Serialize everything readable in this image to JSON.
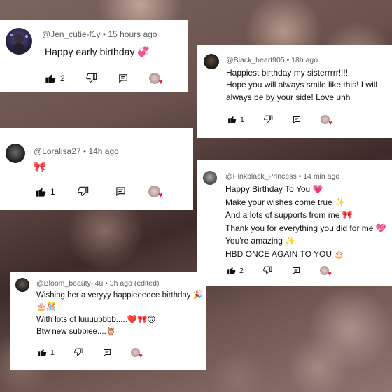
{
  "comments": [
    {
      "handle": "@Jen_cutie-f1y",
      "time": "15 hours ago",
      "lines": [
        "Happy early birthday 💞"
      ],
      "likes": "2"
    },
    {
      "handle": "@Black_heart905",
      "time": "18h ago",
      "lines": [
        "Happiest birthday my sisterrrrr!!!!",
        "Hope you will always smile like this! I will",
        "always be by your side! Love uhh"
      ],
      "likes": "1"
    },
    {
      "handle": "@Loralisa27",
      "time": "14h ago",
      "lines": [
        "🎀"
      ],
      "likes": "1"
    },
    {
      "handle": "@Pinkblack_Princess",
      "time": "14 min ago",
      "lines": [
        "Happy Birthday To You 💗",
        "Make your wishes come true ✨",
        "And a lots of supports from me 🎀",
        "Thank you for everything you did for me 💖",
        "You're amazing ✨",
        "HBD ONCE AGAIN TO YOU 🎂"
      ],
      "likes": "2"
    },
    {
      "handle": "@Bloom_beauty-i4u",
      "time": "3h ago (edited)",
      "lines": [
        "Wishing her a veryyy happieeeeee birthday 🎉",
        "🎂🎊",
        "With lots of luuuubbbb.....❤️🎀🙃",
        "Btw new subbiee....🦉"
      ],
      "likes": "1"
    }
  ],
  "colors": {
    "heart": "#e2203a",
    "meta_text": "#606060",
    "body_text": "#0f0f0f"
  },
  "icons": [
    "like-icon",
    "dislike-icon",
    "reply-icon",
    "creator-heart-icon"
  ]
}
